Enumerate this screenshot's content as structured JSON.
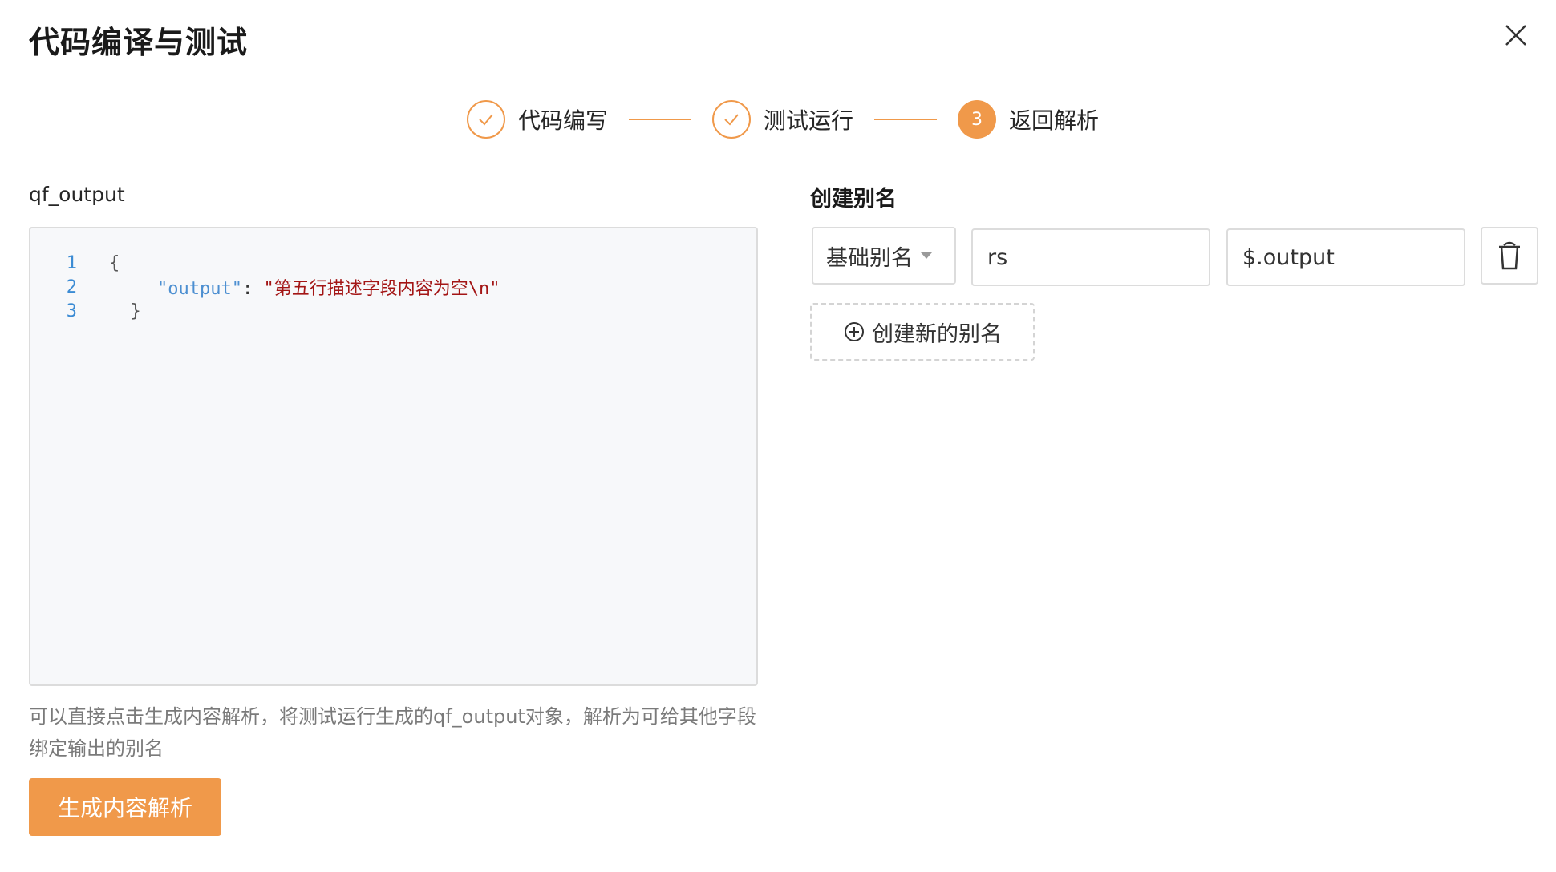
{
  "dialog": {
    "title": "代码编译与测试"
  },
  "steps": [
    {
      "label": "代码编写",
      "state": "done"
    },
    {
      "label": "测试运行",
      "state": "done"
    },
    {
      "label": "返回解析",
      "state": "active",
      "number": "3"
    }
  ],
  "left": {
    "label": "qf_output",
    "code_lines": [
      {
        "num": "1",
        "text": "{"
      },
      {
        "num": "2",
        "key": "\"output\"",
        "sep": ": ",
        "value": "\"第五行描述字段内容为空\\n\""
      },
      {
        "num": "3",
        "text": "  }"
      }
    ],
    "hint": "可以直接点击生成内容解析，将测试运行生成的qf_output对象，解析为可给其他字段绑定输出的别名",
    "generate_button": "生成内容解析"
  },
  "right": {
    "title": "创建别名",
    "alias_type": "基础别名",
    "alias_name": "rs",
    "alias_path": "$.output",
    "add_alias_label": "创建新的别名"
  },
  "colors": {
    "accent": "#f0994a",
    "border": "#dcdcdc",
    "editor_bg": "#f7f8fa"
  }
}
